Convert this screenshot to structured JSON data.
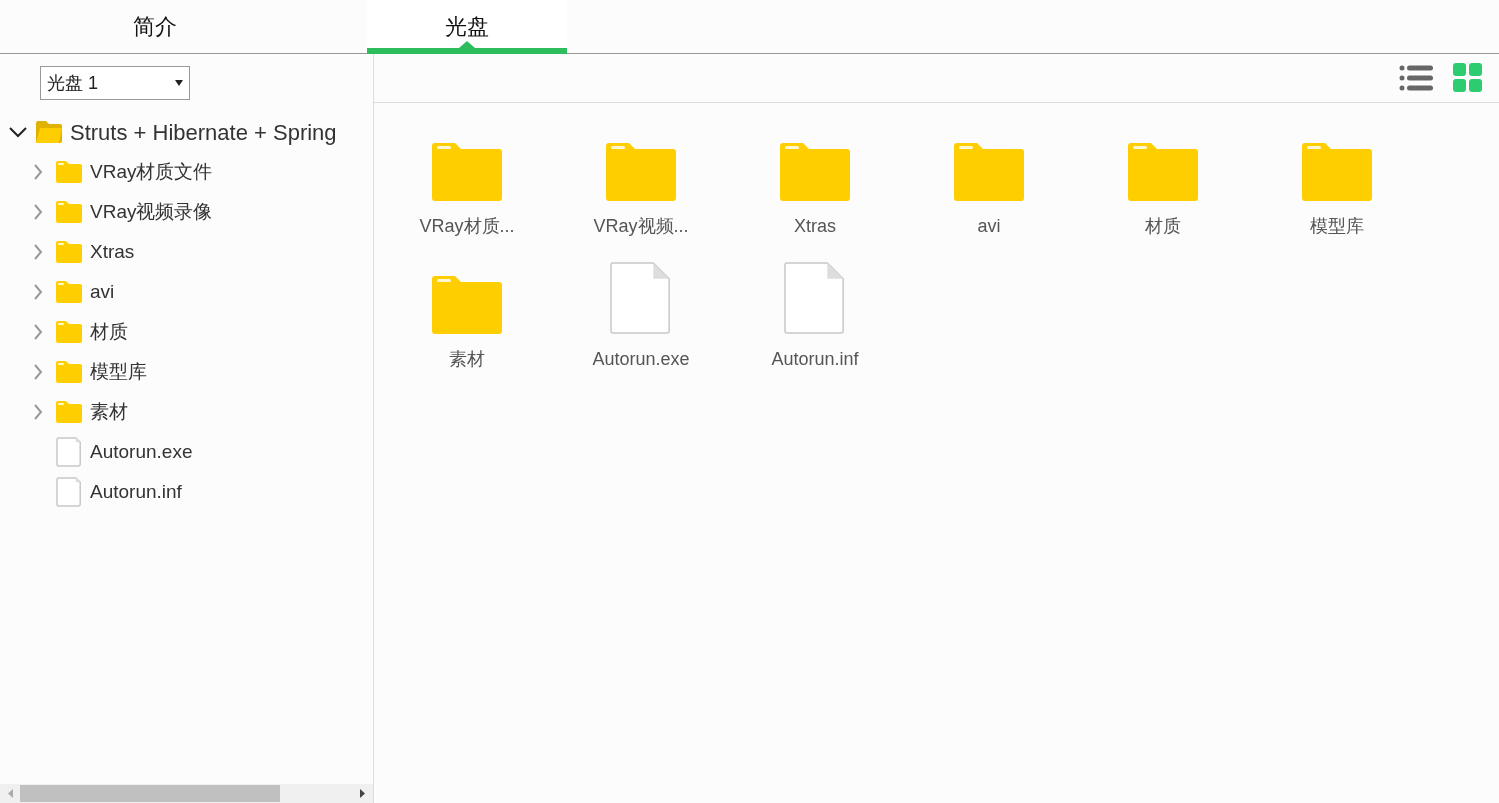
{
  "tabs": [
    {
      "label": "简介",
      "selected": false
    },
    {
      "label": "光盘",
      "selected": true
    }
  ],
  "disc_select": {
    "value": "光盘 1"
  },
  "tree": [
    {
      "label": "Struts + Hibernate + Spring",
      "kind": "folder",
      "expanded": true,
      "children": [
        {
          "label": "VRay材质文件",
          "kind": "folder",
          "expanded": false
        },
        {
          "label": "VRay视频录像",
          "kind": "folder",
          "expanded": false
        },
        {
          "label": "Xtras",
          "kind": "folder",
          "expanded": false
        },
        {
          "label": "avi",
          "kind": "folder",
          "expanded": false
        },
        {
          "label": "材质",
          "kind": "folder",
          "expanded": false
        },
        {
          "label": "模型库",
          "kind": "folder",
          "expanded": false
        },
        {
          "label": "素材",
          "kind": "folder",
          "expanded": false
        },
        {
          "label": "Autorun.exe",
          "kind": "file"
        },
        {
          "label": "Autorun.inf",
          "kind": "file"
        }
      ]
    }
  ],
  "view_modes": [
    {
      "kind": "list",
      "selected": false
    },
    {
      "kind": "grid",
      "selected": true
    }
  ],
  "items": [
    {
      "name": "VRay材质...",
      "kind": "folder"
    },
    {
      "name": "VRay视频...",
      "kind": "folder"
    },
    {
      "name": "Xtras",
      "kind": "folder"
    },
    {
      "name": "avi",
      "kind": "folder"
    },
    {
      "name": "材质",
      "kind": "folder"
    },
    {
      "name": "模型库",
      "kind": "folder"
    },
    {
      "name": "素材",
      "kind": "folder"
    },
    {
      "name": "Autorun.exe",
      "kind": "file"
    },
    {
      "name": "Autorun.inf",
      "kind": "file"
    }
  ]
}
